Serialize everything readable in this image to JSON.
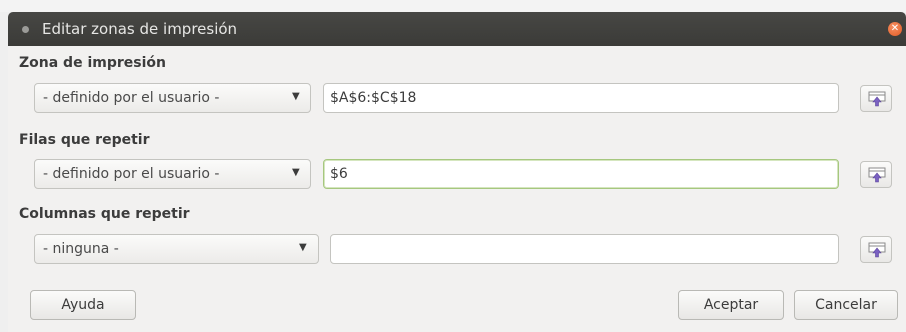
{
  "window": {
    "title": "Editar zonas de impresión"
  },
  "sections": {
    "print_range": {
      "label": "Zona de impresión",
      "combo_value": "- definido por el usuario -",
      "field_value": "$A$6:$C$18"
    },
    "rows_repeat": {
      "label": "Filas que repetir",
      "combo_value": "- definido por el usuario -",
      "field_value": "$6"
    },
    "cols_repeat": {
      "label": "Columnas que repetir",
      "combo_value": "- ninguna -",
      "field_value": ""
    }
  },
  "buttons": {
    "help": "Ayuda",
    "ok": "Aceptar",
    "cancel": "Cancelar"
  },
  "icons": {
    "close": "close-icon",
    "collapse": "shrink-selector-icon",
    "dropdown": "chevron-down-icon"
  },
  "colors": {
    "titlebar": "#3e3e3b",
    "close": "#e8662f",
    "focus_border": "#a6c77f"
  }
}
